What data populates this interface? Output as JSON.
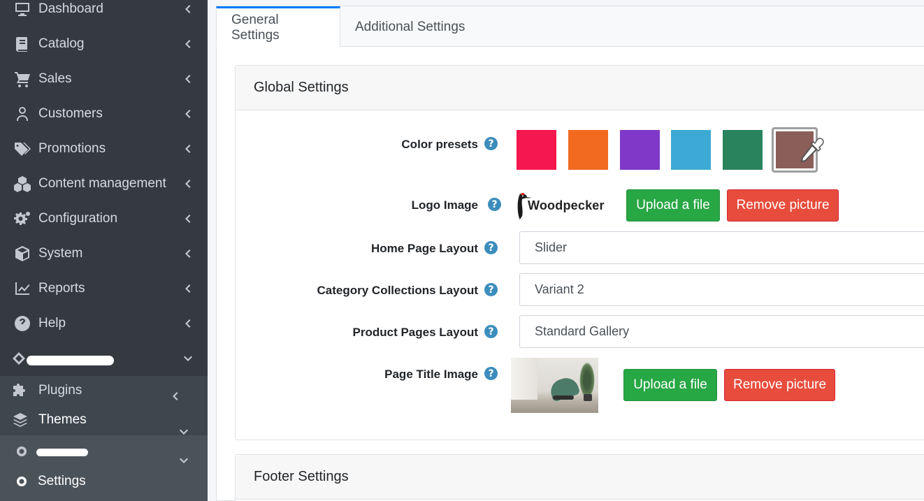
{
  "sidebar": {
    "items": [
      {
        "label": "Dashboard",
        "icon": "monitor-icon"
      },
      {
        "label": "Catalog",
        "icon": "book-icon"
      },
      {
        "label": "Sales",
        "icon": "cart-icon"
      },
      {
        "label": "Customers",
        "icon": "user-icon"
      },
      {
        "label": "Promotions",
        "icon": "tags-icon"
      },
      {
        "label": "Content management",
        "icon": "cubes-icon"
      },
      {
        "label": "Configuration",
        "icon": "gears-icon"
      },
      {
        "label": "System",
        "icon": "cube-icon"
      },
      {
        "label": "Reports",
        "icon": "chart-line-icon"
      },
      {
        "label": "Help",
        "icon": "question-circle-icon"
      }
    ],
    "plugins_label": "Plugins",
    "themes_label": "Themes",
    "settings_label": "Settings"
  },
  "tabs": [
    {
      "label": "General Settings",
      "active": true
    },
    {
      "label": "Additional Settings",
      "active": false
    }
  ],
  "global_settings": {
    "title": "Global Settings",
    "color_presets_label": "Color presets",
    "color_presets": [
      "#f5174f",
      "#f26a20",
      "#7f38c8",
      "#3da9d5",
      "#29845e"
    ],
    "selected_color": "#8b5e5a",
    "logo_image_label": "Logo Image",
    "logo_text": "Woodpecker",
    "upload_label": "Upload a file",
    "remove_label": "Remove picture",
    "home_page_layout_label": "Home Page Layout",
    "home_page_layout_value": "Slider",
    "category_layout_label": "Category Collections Layout",
    "category_layout_value": "Variant 2",
    "product_layout_label": "Product Pages Layout",
    "product_layout_value": "Standard Gallery",
    "page_title_image_label": "Page Title Image",
    "help_glyph": "?"
  },
  "footer_settings": {
    "title": "Footer Settings"
  }
}
